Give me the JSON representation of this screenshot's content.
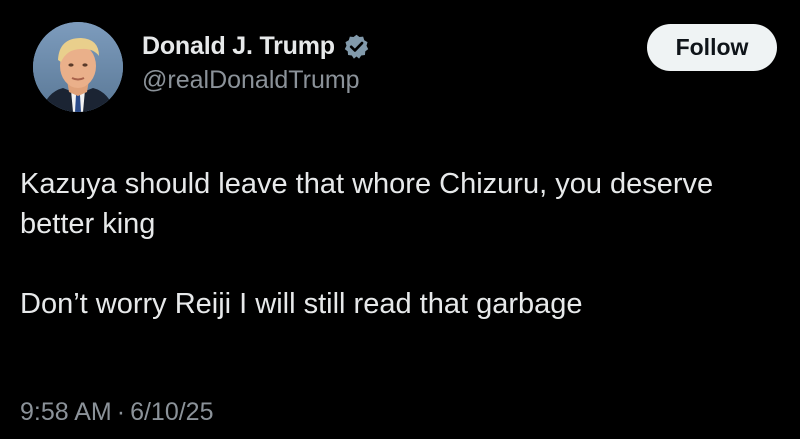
{
  "author": {
    "display_name": "Donald J. Trump",
    "handle": "@realDonaldTrump",
    "verified": true,
    "avatar_icon": "profile-photo"
  },
  "actions": {
    "follow_label": "Follow"
  },
  "tweet": {
    "line_1": "Kazuya should leave that whore Chizuru, you deserve better king",
    "line_2": "Don’t worry Reiji I will still read that garbage"
  },
  "meta": {
    "time": "9:58 AM",
    "separator": "·",
    "date": "6/10/25"
  },
  "colors": {
    "background": "#000000",
    "text_primary": "#e7e9ea",
    "text_secondary": "#8b9299",
    "follow_bg": "#eff3f4",
    "verified_badge": "#829aab"
  }
}
